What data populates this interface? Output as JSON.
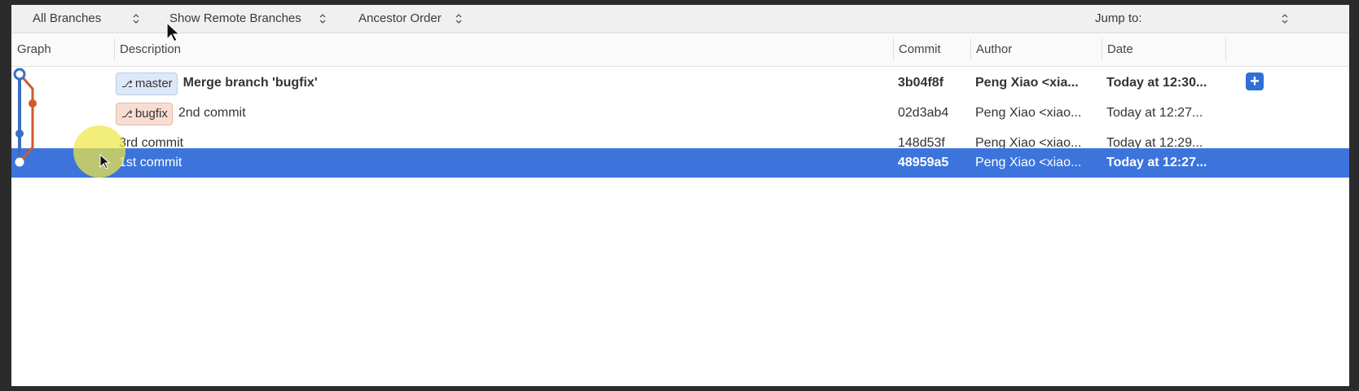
{
  "toolbar": {
    "branches": "All Branches",
    "remote": "Show Remote Branches",
    "order": "Ancestor Order",
    "jump_to": "Jump to:"
  },
  "columns": {
    "graph": "Graph",
    "description": "Description",
    "commit": "Commit",
    "author": "Author",
    "date": "Date"
  },
  "rows": [
    {
      "tag": "master",
      "description": "Merge branch 'bugfix'",
      "commit": "3b04f8f",
      "author": "Peng Xiao <xia...",
      "date": "Today at 12:30..."
    },
    {
      "tag": "bugfix",
      "description": "2nd commit",
      "commit": "02d3ab4",
      "author": "Peng Xiao <xiao...",
      "date": "Today at 12:27..."
    },
    {
      "tag": "",
      "description": "3rd commit",
      "commit": "148d53f",
      "author": "Peng Xiao <xiao...",
      "date": "Today at 12:29..."
    },
    {
      "tag": "",
      "description": "1st commit",
      "commit": "48959a5",
      "author": "Peng Xiao <xiao...",
      "date": "Today at 12:27..."
    }
  ],
  "add_button": "+",
  "colors": {
    "selection": "#3c74dc",
    "master_branch": "#3a6fc4",
    "bugfix_branch": "#cf5a2c",
    "highlight": "#eee846"
  }
}
